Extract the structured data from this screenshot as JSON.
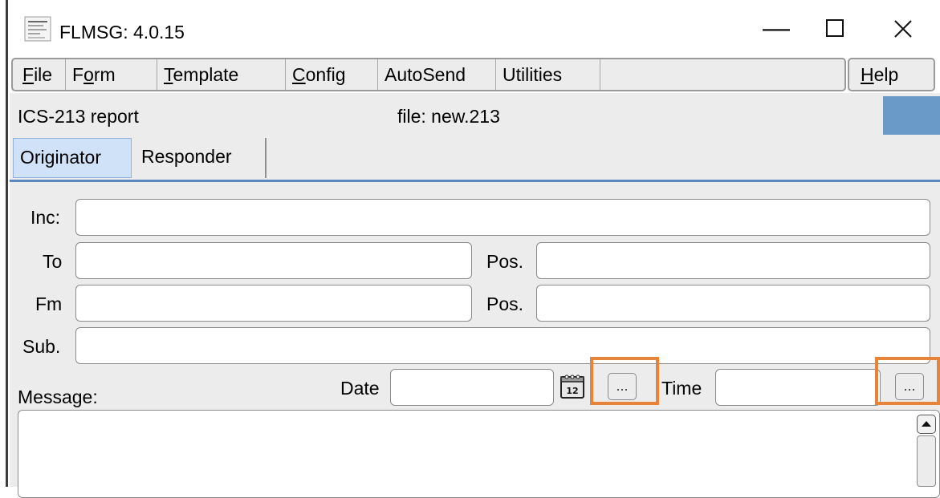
{
  "window": {
    "title": "FLMSG: 4.0.15",
    "minimize": "—",
    "maximize": "☐",
    "close": "✕"
  },
  "menu": {
    "items": [
      {
        "pre": "",
        "key": "F",
        "post": "ile"
      },
      {
        "pre": "F",
        "key": "o",
        "post": "rm"
      },
      {
        "pre": "",
        "key": "T",
        "post": "emplate"
      },
      {
        "pre": "",
        "key": "C",
        "post": "onfig"
      },
      {
        "pre": "AutoSend",
        "key": "",
        "post": ""
      },
      {
        "pre": "Utilities",
        "key": "",
        "post": ""
      }
    ],
    "help": {
      "pre": "",
      "key": "H",
      "post": "elp"
    }
  },
  "info": {
    "report": "ICS-213 report",
    "file": "file: new.213",
    "status_color": "#6a9ac8"
  },
  "tabs": {
    "originator": "Originator",
    "responder": "Responder",
    "active": "Originator"
  },
  "form": {
    "inc_label": "Inc:",
    "to_label": "To",
    "fm_label": "Fm",
    "pos_label": "Pos.",
    "sub_label": "Sub.",
    "date_label": "Date",
    "time_label": "Time",
    "message_label": "Message:",
    "ellipsis": "...",
    "calendar_day": "12",
    "values": {
      "inc": "",
      "to": "",
      "to_pos": "",
      "fm": "",
      "fm_pos": "",
      "sub": "",
      "date": "",
      "time": "",
      "message": ""
    }
  },
  "colors": {
    "highlight": "#e8833a",
    "active_tab": "#cfe2f7",
    "tab_rule": "#5b87c0"
  }
}
